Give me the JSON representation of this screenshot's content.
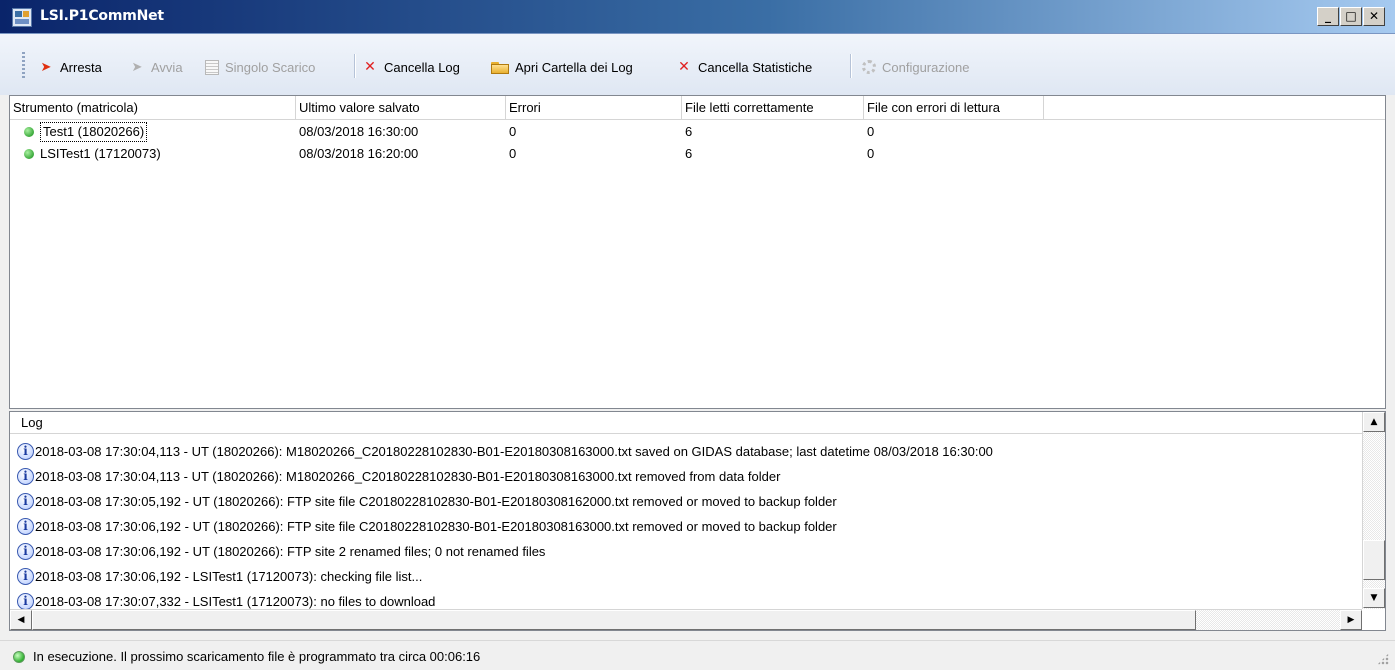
{
  "window": {
    "title": "LSI.P1CommNet",
    "controls": {
      "minimize": "_",
      "maximize": "□",
      "close": "✕"
    }
  },
  "toolbar": {
    "stop_label": "Arresta",
    "start_label": "Avvia",
    "single_download_label": "Singolo Scarico",
    "clear_log_label": "Cancella Log",
    "open_log_folder_label": "Apri Cartella dei Log",
    "clear_stats_label": "Cancella Statistiche",
    "config_label": "Configurazione"
  },
  "instruments": {
    "columns": [
      "Strumento (matricola)",
      "Ultimo valore salvato",
      "Errori",
      "File letti correttamente",
      "File con errori di lettura"
    ],
    "rows": [
      {
        "name": "Test1 (18020266)",
        "last_saved": "08/03/2018 16:30:00",
        "errors": "0",
        "files_ok": "6",
        "files_err": "0",
        "status_color": "#3aa83a"
      },
      {
        "name": "LSITest1 (17120073)",
        "last_saved": "08/03/2018 16:20:00",
        "errors": "0",
        "files_ok": "6",
        "files_err": "0",
        "status_color": "#3aa83a"
      }
    ]
  },
  "log": {
    "header": "Log",
    "lines": [
      "2018-03-08 17:30:04,113 - UT (18020266): M18020266_C20180228102830-B01-E20180308163000.txt saved on GIDAS database; last datetime 08/03/2018 16:30:00",
      "2018-03-08 17:30:04,113 - UT (18020266): M18020266_C20180228102830-B01-E20180308163000.txt removed from data folder",
      "2018-03-08 17:30:05,192 - UT (18020266): FTP site file C20180228102830-B01-E20180308162000.txt removed or moved to backup folder",
      "2018-03-08 17:30:06,192 - UT (18020266): FTP site file C20180228102830-B01-E20180308163000.txt removed or moved to backup folder",
      "2018-03-08 17:30:06,192 - UT (18020266): FTP site 2 renamed files; 0 not renamed files",
      "2018-03-08 17:30:06,192 - LSITest1 (17120073): checking file list...",
      "2018-03-08 17:30:07,332 - LSITest1 (17120073): no files to download"
    ]
  },
  "status": {
    "text": "In esecuzione. Il prossimo scaricamento file è programmato tra circa 00:06:16"
  },
  "colors": {
    "title_bar_start": "#0a246a",
    "status_ok": "#30b030",
    "action_red": "#e03010"
  }
}
